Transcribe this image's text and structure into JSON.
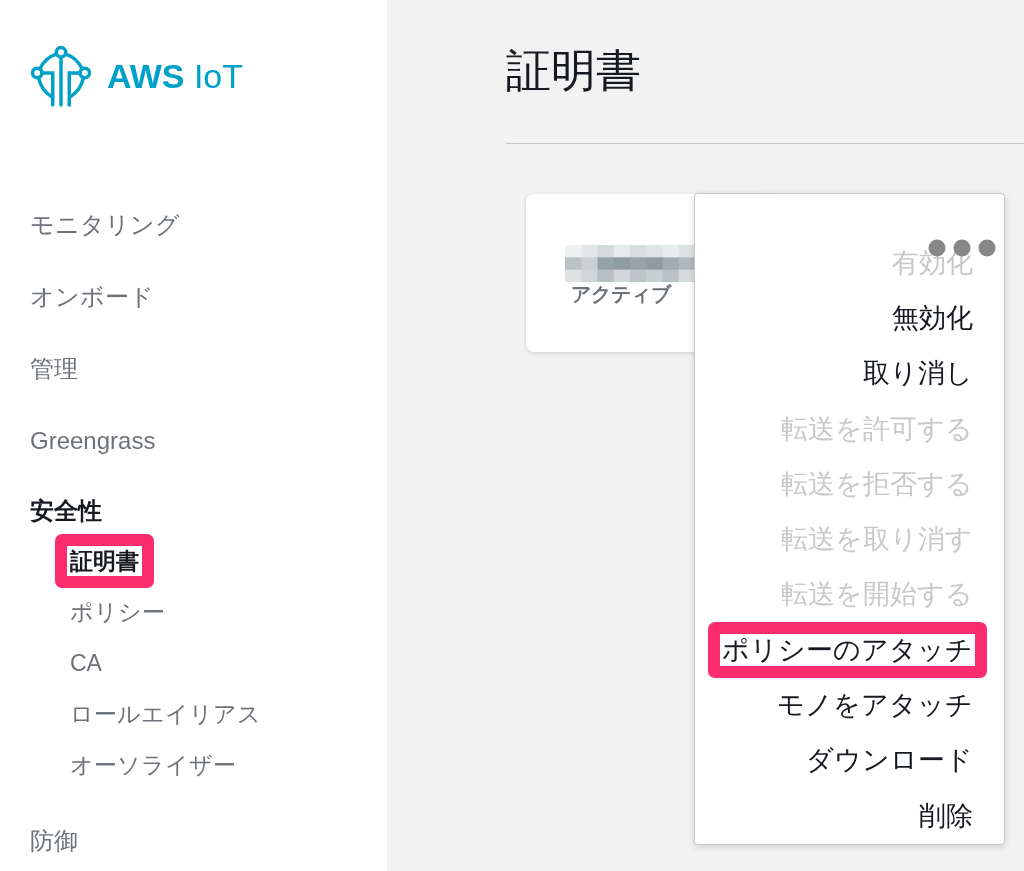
{
  "sidebar": {
    "logo": {
      "text": "**AWS** IoT"
    },
    "items": [
      {
        "label": "モニタリング",
        "expanded": false
      },
      {
        "label": "オンボード",
        "expanded": false
      },
      {
        "label": "管理",
        "expanded": false
      },
      {
        "label": "Greengrass",
        "expanded": false
      },
      {
        "label": "安全性",
        "expanded": true,
        "children": [
          {
            "label": "証明書",
            "selected": true,
            "highlighted": true
          },
          {
            "label": "ポリシー",
            "selected": false,
            "highlighted": false
          },
          {
            "label": "CA",
            "selected": false,
            "highlighted": false
          },
          {
            "label": "ロールエイリアス",
            "selected": false,
            "highlighted": false
          },
          {
            "label": "オーソライザー",
            "selected": false,
            "highlighted": false
          }
        ]
      },
      {
        "label": "防御",
        "expanded": false
      }
    ]
  },
  "main": {
    "title": "証明書"
  },
  "certificate_card": {
    "status": "アクティブ"
  },
  "actions_menu": {
    "items": [
      {
        "label": "有効化",
        "disabled": true,
        "highlighted": false
      },
      {
        "label": "無効化",
        "disabled": false,
        "highlighted": false
      },
      {
        "label": "取り消し",
        "disabled": false,
        "highlighted": false
      },
      {
        "label": "転送を許可する",
        "disabled": true,
        "highlighted": false
      },
      {
        "label": "転送を拒否する",
        "disabled": true,
        "highlighted": false
      },
      {
        "label": "転送を取り消す",
        "disabled": true,
        "highlighted": false
      },
      {
        "label": "転送を開始する",
        "disabled": true,
        "highlighted": false
      },
      {
        "label": "ポリシーのアタッチ",
        "disabled": false,
        "highlighted": true
      },
      {
        "label": "モノをアタッチ",
        "disabled": false,
        "highlighted": false
      },
      {
        "label": "ダウンロード",
        "disabled": false,
        "highlighted": false
      },
      {
        "label": "削除",
        "disabled": false,
        "highlighted": false
      }
    ]
  }
}
